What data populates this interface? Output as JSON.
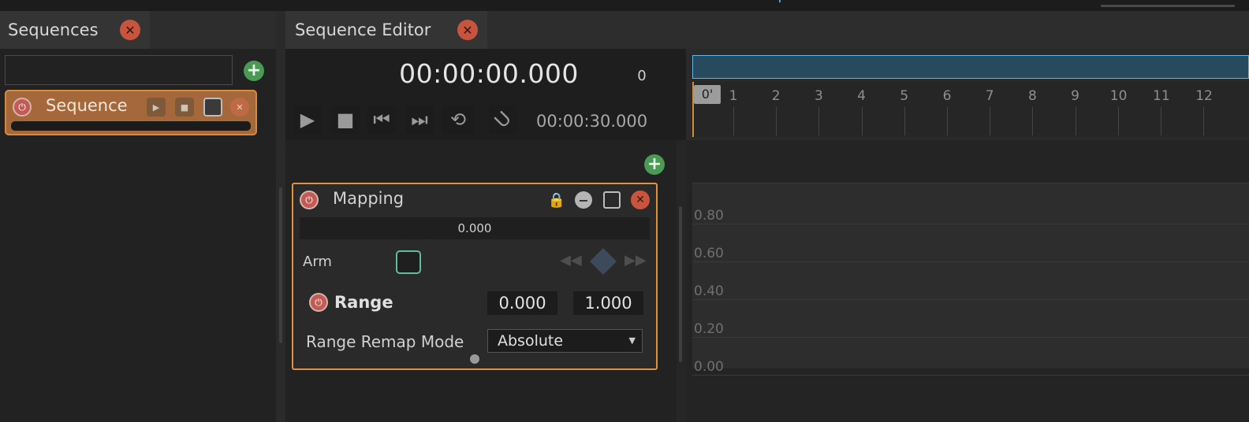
{
  "sequences_panel": {
    "tab_label": "Sequences",
    "close_icon": "close-icon",
    "search": {
      "value": "",
      "placeholder": ""
    },
    "add_icon": "plus-icon",
    "items": [
      {
        "label": "Sequence",
        "progress": 0
      }
    ]
  },
  "editor": {
    "tab_label": "Sequence Editor",
    "current_time": "00:00:00.000",
    "current_frame": "0",
    "total_time": "00:00:30.000",
    "transport": [
      "play-icon",
      "stop-icon",
      "previous-icon",
      "next-icon",
      "loop-icon",
      "magnet-icon"
    ],
    "ruler": {
      "cursor_label": "0'",
      "ticks": [
        "1",
        "2",
        "3",
        "4",
        "5",
        "6",
        "7",
        "8",
        "9",
        "10",
        "11",
        "12"
      ]
    },
    "layer": {
      "title": "Mapping",
      "value": "0.000",
      "arm_label": "Arm",
      "range_label": "Range",
      "range_min": "0.000",
      "range_max": "1.000",
      "remap_label": "Range Remap Mode",
      "remap_value": "Absolute"
    },
    "graph": {
      "y_labels": [
        "0.80",
        "0.60",
        "0.40",
        "0.20",
        "0.00"
      ]
    }
  },
  "colors": {
    "accent_orange": "#e2913e",
    "close_red": "#c9543d",
    "add_green": "#4a9a55",
    "arm_teal": "#5fbca0",
    "range_blue": "#60b6e6"
  }
}
